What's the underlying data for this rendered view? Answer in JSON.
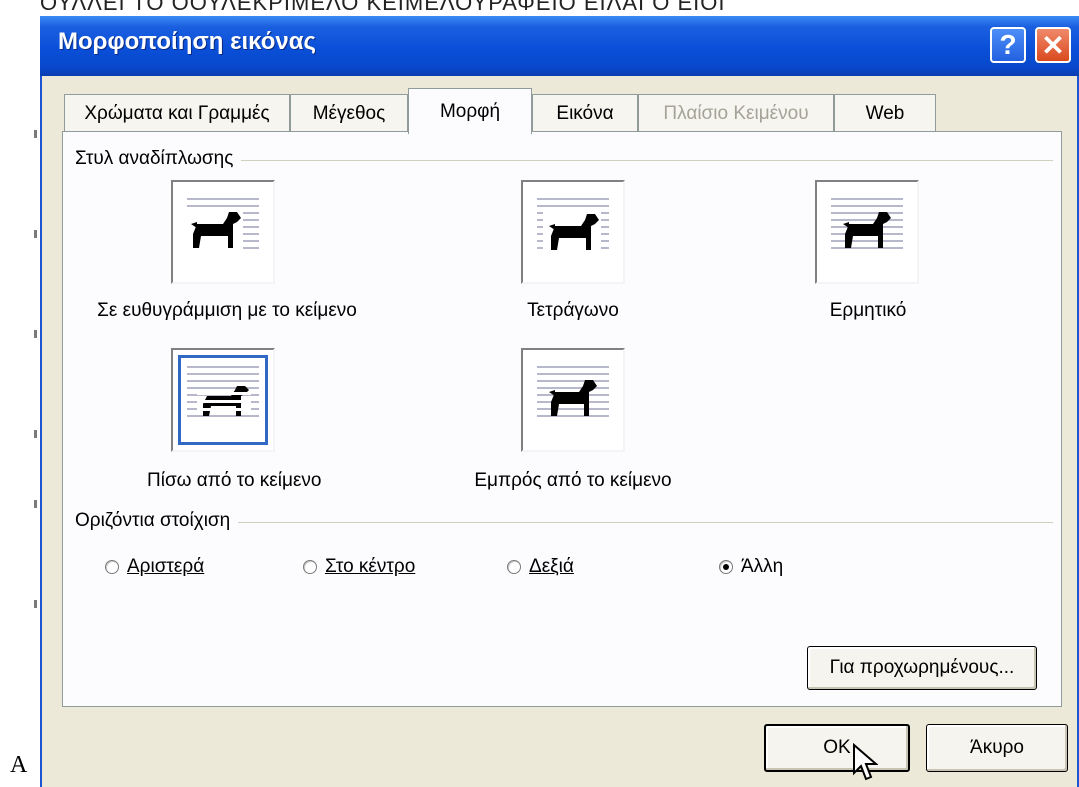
{
  "background": {
    "top_text": "ΟΥΛΛΕΙ ΤΟ ΟΟΥΛΕΚΡΙΜΕΛΟ ΚΕΙΜΕΛΟΥΡΑΦΕΙΟ ΕΙΛΑΙ Ο ΕΙΟΙ",
    "left_text": "A"
  },
  "dialog": {
    "title": "Μορφοποίηση εικόνας",
    "help_glyph": "?",
    "close_glyph": "✕",
    "tabs": [
      {
        "label": "Χρώματα και Γραμμές"
      },
      {
        "label": "Μέγεθος"
      },
      {
        "label": "Μορφή"
      },
      {
        "label": "Εικόνα"
      },
      {
        "label": "Πλαίσιο Κειμένου"
      },
      {
        "label": "Web"
      }
    ],
    "wrap_section": {
      "label": "Στυλ αναδίπλωσης",
      "options": [
        {
          "label": "Σε ευθυγράμμιση με το κείμενο",
          "icon": "dog-inline-icon",
          "selected": false
        },
        {
          "label": "Τετράγωνο",
          "icon": "dog-square-icon",
          "selected": false
        },
        {
          "label": "Ερμητικό",
          "icon": "dog-tight-icon",
          "selected": false
        },
        {
          "label": "Πίσω από το κείμενο",
          "icon": "dog-behind-text-icon",
          "selected": true
        },
        {
          "label": "Εμπρός από το κείμενο",
          "icon": "dog-in-front-icon",
          "selected": false
        }
      ]
    },
    "align_section": {
      "label": "Οριζόντια στοίχιση",
      "options": [
        {
          "label": "Αριστερά",
          "checked": false
        },
        {
          "label": "Στο κέντρο",
          "checked": false
        },
        {
          "label": "Δεξιά",
          "checked": false
        },
        {
          "label": "Άλλη",
          "checked": true
        }
      ]
    },
    "advanced_button": "Για προχωρημένους...",
    "ok_button": "OK",
    "cancel_button": "Άκυρο"
  },
  "colors": {
    "title_bar": "#0a4fd8",
    "dialog_face": "#ece9d8",
    "panel": "#fcfcfe",
    "selection": "#316ac5"
  }
}
